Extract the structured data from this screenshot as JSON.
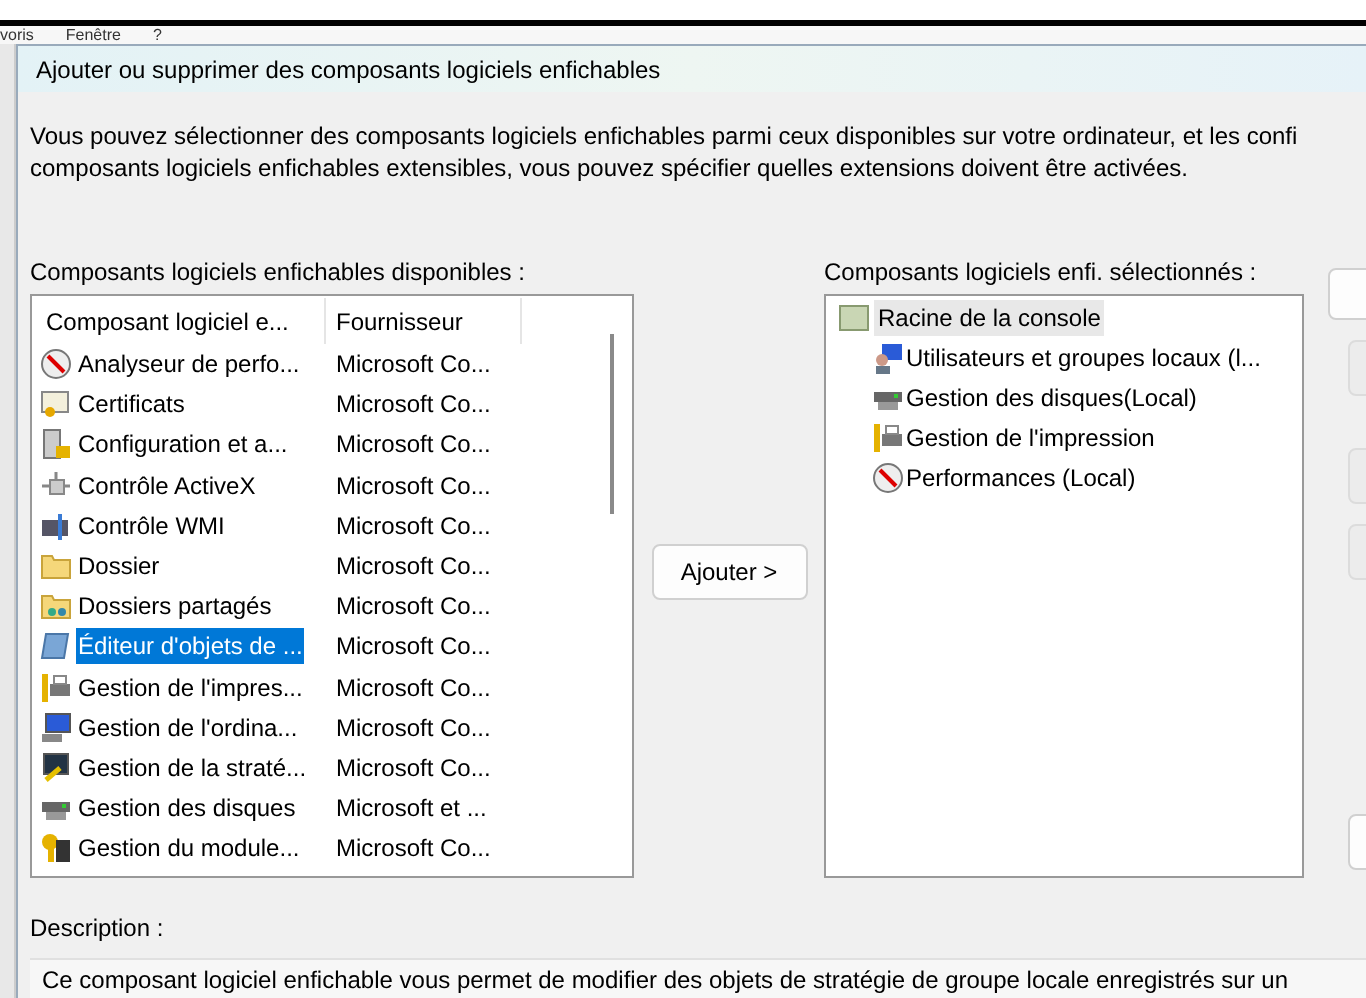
{
  "background_menu": [
    "voris",
    "Fenêtre",
    "?"
  ],
  "dialog": {
    "title": "Ajouter ou supprimer des composants logiciels enfichables",
    "intro": [
      "Vous pouvez sélectionner des composants logiciels enfichables parmi ceux disponibles sur votre ordinateur, et les confi",
      "composants logiciels enfichables extensibles, vous pouvez spécifier quelles extensions doivent être activées."
    ],
    "available": {
      "label": "Composants logiciels enfichables disponibles :",
      "columns": [
        "Composant logiciel e...",
        "Fournisseur"
      ],
      "rows": [
        {
          "name": "Analyseur de perfo...",
          "vendor": "Microsoft Co...",
          "selected": false
        },
        {
          "name": "Certificats",
          "vendor": "Microsoft Co...",
          "selected": false
        },
        {
          "name": "Configuration et a...",
          "vendor": "Microsoft Co...",
          "selected": false
        },
        {
          "name": "Contrôle ActiveX",
          "vendor": "Microsoft Co...",
          "selected": false
        },
        {
          "name": "Contrôle WMI",
          "vendor": "Microsoft Co...",
          "selected": false
        },
        {
          "name": "Dossier",
          "vendor": "Microsoft Co...",
          "selected": false
        },
        {
          "name": "Dossiers partagés",
          "vendor": "Microsoft Co...",
          "selected": false
        },
        {
          "name": "Éditeur d'objets de ...",
          "vendor": "Microsoft Co...",
          "selected": true
        },
        {
          "name": "Gestion de l'impres...",
          "vendor": "Microsoft Co...",
          "selected": false
        },
        {
          "name": "Gestion de l'ordina...",
          "vendor": "Microsoft Co...",
          "selected": false
        },
        {
          "name": "Gestion de la straté...",
          "vendor": "Microsoft Co...",
          "selected": false
        },
        {
          "name": "Gestion des disques",
          "vendor": "Microsoft et ...",
          "selected": false
        },
        {
          "name": "Gestion du module...",
          "vendor": "Microsoft Co...",
          "selected": false
        }
      ]
    },
    "add_button": "Ajouter >",
    "selected_snapins": {
      "label": "Composants logiciels enfi. sélectionnés :",
      "tree": [
        {
          "label": "Racine de la console",
          "selected": true,
          "children": [
            {
              "label": "Utilisateurs et groupes locaux (l...",
              "selected": false
            },
            {
              "label": "Gestion des disques(Local)",
              "selected": false
            },
            {
              "label": "Gestion de l'impression",
              "selected": false
            },
            {
              "label": "Performances (Local)",
              "selected": false
            }
          ]
        }
      ]
    },
    "description": {
      "label": "Description :",
      "text": "Ce composant logiciel enfichable vous permet de modifier des objets de stratégie de groupe locale enregistrés sur un"
    }
  }
}
